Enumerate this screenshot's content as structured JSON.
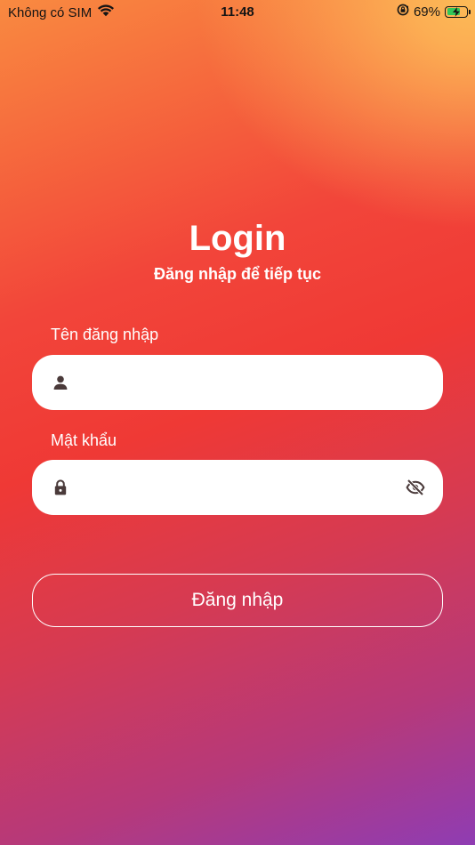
{
  "status_bar": {
    "carrier": "Không có SIM",
    "time": "11:48",
    "battery_percent": "69%",
    "battery_level": 0.69,
    "icons": [
      "wifi-icon",
      "orientation-lock-icon",
      "battery-charging-icon"
    ]
  },
  "header": {
    "title": "Login",
    "subtitle": "Đăng nhập để tiếp tục"
  },
  "form": {
    "username": {
      "label": "Tên đăng nhập",
      "value": "",
      "icon": "person-icon"
    },
    "password": {
      "label": "Mật khẩu",
      "value": "",
      "icon": "lock-icon",
      "toggle_icon": "eye-off-icon"
    },
    "submit_label": "Đăng nhập"
  },
  "colors": {
    "gradient_top": "#fdbb57",
    "gradient_mid": "#ef3935",
    "gradient_bottom": "#8f3cb3",
    "icon_color": "#4a3a3a",
    "field_background": "#ffffff"
  }
}
